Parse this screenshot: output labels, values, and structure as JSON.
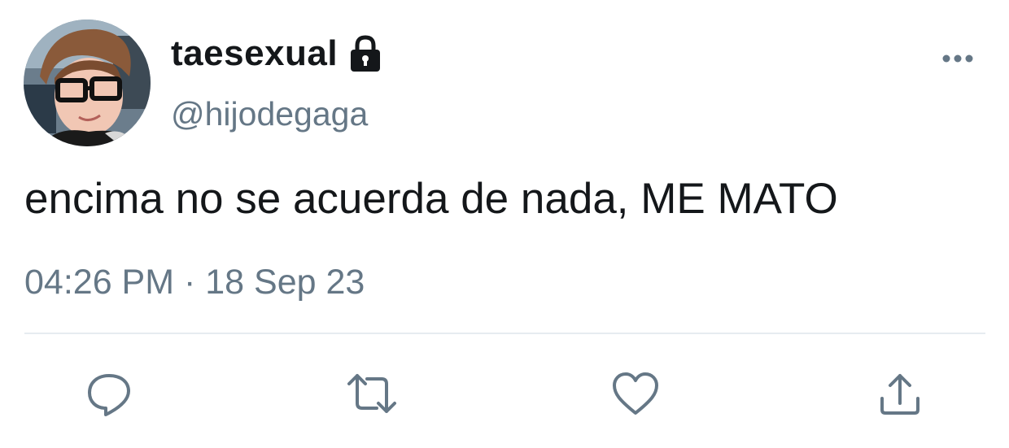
{
  "user": {
    "display_name": "taesexual",
    "handle": "@hijodegaga",
    "protected_icon": "lock-icon",
    "avatar": "profile-photo"
  },
  "tweet": {
    "text": "encima no se acuerda de nada, ME MATO",
    "timestamp": "04:26 PM · 18 Sep 23"
  },
  "menu_icon": "more-options-icon",
  "actions": [
    {
      "name": "reply",
      "icon": "reply-icon"
    },
    {
      "name": "retweet",
      "icon": "retweet-icon"
    },
    {
      "name": "like",
      "icon": "heart-icon"
    },
    {
      "name": "share",
      "icon": "share-icon"
    }
  ],
  "colors": {
    "text_primary": "#14171a",
    "text_secondary": "#657786",
    "divider": "#e6ecf0",
    "icon": "#657786"
  }
}
